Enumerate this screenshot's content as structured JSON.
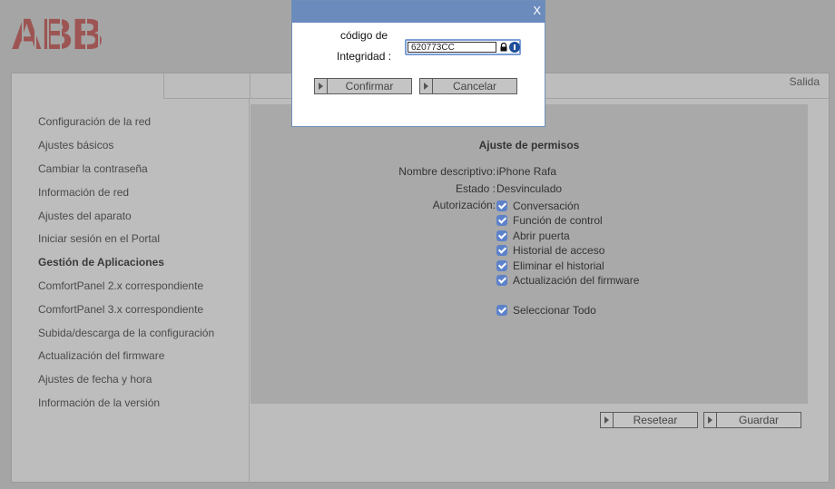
{
  "brand": {
    "logo_text": "ABB"
  },
  "header": {
    "exit_label": "Salida"
  },
  "sidebar": {
    "items": [
      {
        "label": "Configuración de la red"
      },
      {
        "label": "Ajustes básicos"
      },
      {
        "label": "Cambiar la contraseña"
      },
      {
        "label": "Información de red"
      },
      {
        "label": "Ajustes del aparato"
      },
      {
        "label": "Iniciar sesión en el Portal"
      },
      {
        "label": "Gestión de Aplicaciones",
        "active": true
      },
      {
        "label": "ComfortPanel 2.x correspondiente"
      },
      {
        "label": "ComfortPanel 3.x correspondiente"
      },
      {
        "label": "Subida/descarga de la configuración"
      },
      {
        "label": "Actualización del firmware"
      },
      {
        "label": "Ajustes de fecha y hora"
      },
      {
        "label": "Información de la versión"
      }
    ]
  },
  "permissions": {
    "title": "Ajuste de permisos",
    "descriptive_name_label": "Nombre descriptivo:",
    "descriptive_name_value": "iPhone Rafa",
    "state_label": "Estado :",
    "state_value": "Desvinculado",
    "authorization_label": "Autorización:",
    "options": [
      {
        "label": "Conversación",
        "checked": true
      },
      {
        "label": "Función de control",
        "checked": true
      },
      {
        "label": "Abrir puerta",
        "checked": true
      },
      {
        "label": "Historial de acceso",
        "checked": true
      },
      {
        "label": "Eliminar el historial",
        "checked": true
      },
      {
        "label": "Actualización del firmware",
        "checked": true
      }
    ],
    "select_all": {
      "label": "Seleccionar Todo",
      "checked": true
    }
  },
  "actions": {
    "reset_label": "Resetear",
    "save_label": "Guardar"
  },
  "dialog": {
    "close_label": "X",
    "field_label_line1": "código de",
    "field_label_line2": "Integridad :",
    "field_value": "620773CC",
    "confirm_label": "Confirmar",
    "cancel_label": "Cancelar"
  },
  "colors": {
    "page_bg": "#a5a5a5",
    "panel_bg": "#bdbdbd",
    "content_bg": "#a9a9a9",
    "checkbox": "#5d82c9",
    "dialog_bar": "#6b8bbd",
    "logo": "#9c5553"
  }
}
